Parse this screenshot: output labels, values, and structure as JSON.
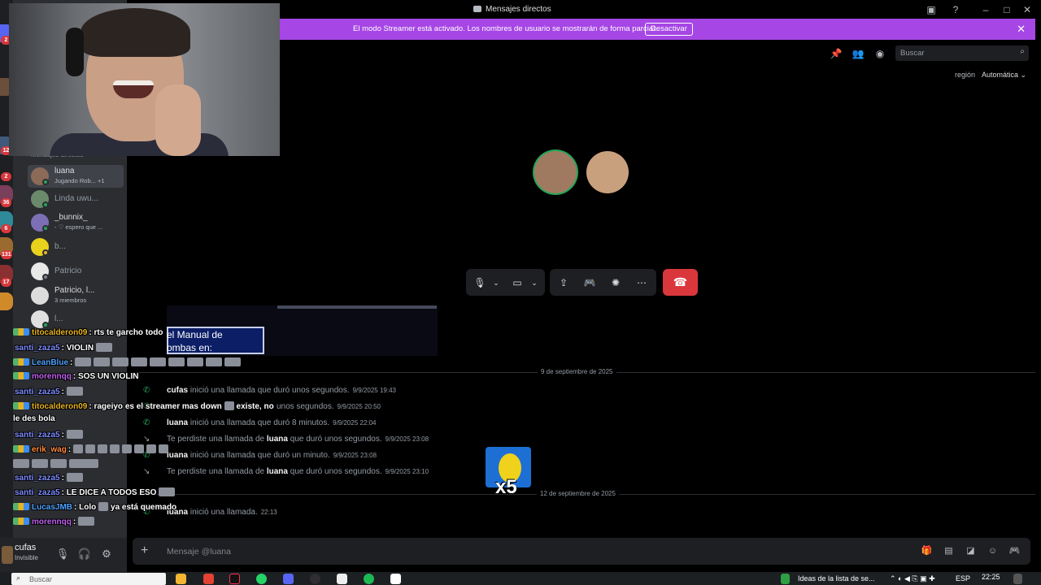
{
  "window": {
    "title": "Mensajes directos"
  },
  "banner": {
    "text": "El modo Streamer está activado. Los nombres de usuario se mostrarán de forma parcial.",
    "button": "Desactivar",
    "color": "#a646e5"
  },
  "server_rail": {
    "badges": [
      "2",
      "2",
      "12",
      "2",
      "36",
      "6",
      "131",
      "17"
    ]
  },
  "sidebar": {
    "section_title": "Mensajes directos",
    "dms": [
      {
        "name": "luana",
        "sub": "Jugando Rob... +1",
        "status": "online",
        "active": true
      },
      {
        "name": "Linda uwu...",
        "sub": "",
        "status": "online"
      },
      {
        "name": "_bunnix_",
        "sub": "- ♡ espero que ...",
        "status": "online"
      },
      {
        "name": "b...",
        "sub": "",
        "status": "idle"
      },
      {
        "name": "Patricio",
        "sub": "",
        "status": "offline"
      },
      {
        "name": "Patricio, l...",
        "sub": "3 miembros",
        "status": ""
      },
      {
        "name": "l...",
        "sub": "",
        "status": "online"
      }
    ]
  },
  "user_panel": {
    "name": "cufas",
    "status": "Invisible"
  },
  "header": {
    "search_placeholder": "Buscar",
    "region_label": "región",
    "region_value": "Automática"
  },
  "call": {
    "participants": [
      "cufas",
      "luana"
    ]
  },
  "media_overlay": {
    "text_line1": "el Manual de",
    "text_line2": "ombas en:"
  },
  "gif_overlay": {
    "multiplier": "x5"
  },
  "chat": {
    "date1": "9 de septiembre de 2025",
    "date2": "12 de septiembre de 2025",
    "messages": [
      {
        "user": "cufas",
        "pre": "",
        "post": " inició una llamada que duró unos segundos.",
        "ts": "9/9/2025 19:43",
        "type": "call"
      },
      {
        "user": "",
        "pre": "",
        "post": "unos segundos.",
        "ts": "9/9/2025 20:50",
        "type": "call"
      },
      {
        "user": "luana",
        "pre": "",
        "post": " inició una llamada que duró 8 minutos.",
        "ts": "9/9/2025 22:04",
        "type": "call"
      },
      {
        "user": "luana",
        "pre": "Te perdiste una llamada de ",
        "post": " que duró unos segundos.",
        "ts": "9/9/2025 23:08",
        "type": "missed"
      },
      {
        "user": "luana",
        "pre": "",
        "post": " inició una llamada que duró un minuto.",
        "ts": "9/9/2025 23:08",
        "type": "call"
      },
      {
        "user": "luana",
        "pre": "Te perdiste una llamada de ",
        "post": " que duró unos segundos.",
        "ts": "9/9/2025 23:10",
        "type": "missed"
      },
      {
        "user": "luana",
        "pre": "",
        "post": " inició una llamada.",
        "ts": "22:13",
        "type": "call"
      }
    ]
  },
  "composer": {
    "placeholder": "Mensaje @luana"
  },
  "stream_chat": [
    {
      "user": "titocalderon09",
      "msg": ": rts te garcho todo",
      "color": "#e7b321"
    },
    {
      "user": "santi_zaza5",
      "msg": ": VIOLIN",
      "color": "#7c8cff"
    },
    {
      "user": "LeanBlue",
      "msg": ":",
      "color": "#4fa3ff"
    },
    {
      "user": "morennqq",
      "msg": ": SOS UN VIOLIN",
      "color": "#c15ff0"
    },
    {
      "user": "santi_zaza5",
      "msg": ":",
      "color": "#7c8cff"
    },
    {
      "user": "titocalderon09",
      "msg": ": rageiyo es el streamer mas down",
      "color": "#e7b321"
    },
    {
      "user": "",
      "msg": "existe, no",
      "color": "#fff"
    },
    {
      "user": "",
      "msg": "le des bola",
      "color": "#fff"
    },
    {
      "user": "santi_zaza5",
      "msg": ":",
      "color": "#7c8cff"
    },
    {
      "user": "erik_wag",
      "msg": ":",
      "color": "#ff8a3d"
    },
    {
      "user": "santi_zaza5",
      "msg": ":",
      "color": "#7c8cff"
    },
    {
      "user": "santi_zaza5",
      "msg": ": LE DICE A TODOS ESO",
      "color": "#7c8cff"
    },
    {
      "user": "LucasJMB",
      "msg": ": Lolo",
      "color": "#4fa3ff"
    },
    {
      "user": "",
      "msg": "ya está quemado",
      "color": "#fff"
    },
    {
      "user": "morennqq",
      "msg": ":",
      "color": "#c15ff0"
    }
  ],
  "taskbar": {
    "search_placeholder": "Buscar",
    "notification": "Ideas de la lista de se...",
    "lang": "ESP",
    "time": "22:25"
  }
}
